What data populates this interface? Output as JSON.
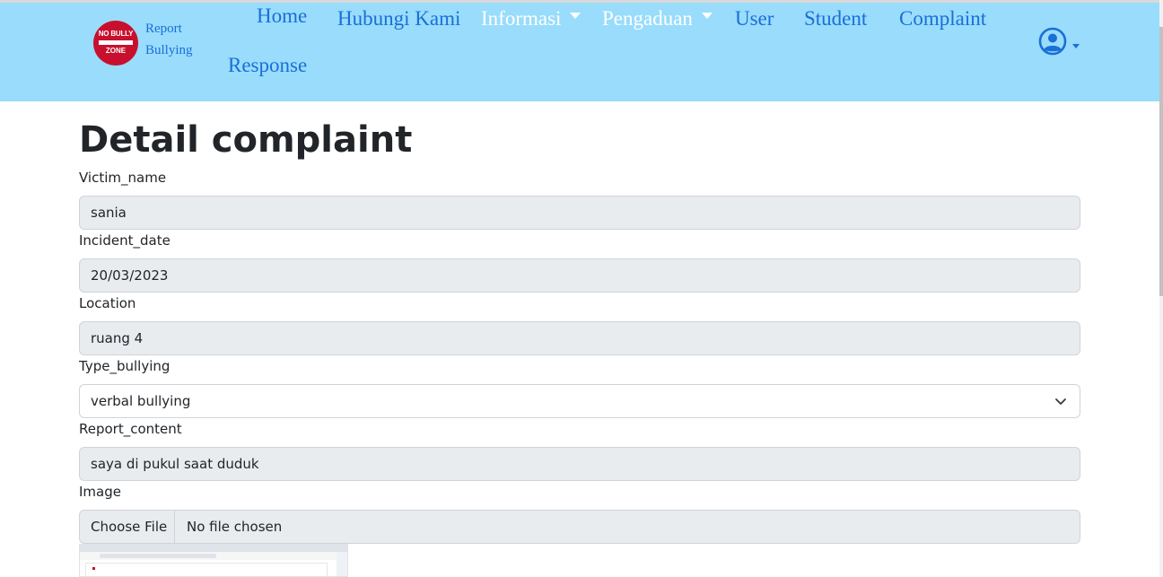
{
  "brand": {
    "logo_line1": "NO BULLY",
    "logo_line2": "ZONE",
    "name_line1": "Report",
    "name_line2": "Bullying"
  },
  "nav": {
    "home": "Home",
    "hubungi": "Hubungi Kami",
    "informasi": "Informasi",
    "pengaduan": "Pengaduan",
    "user": "User",
    "student": "Student",
    "complaint": "Complaint",
    "response": "Response"
  },
  "page": {
    "title": "Detail complaint"
  },
  "form": {
    "victim_label": "Victim_name",
    "victim_value": "sania",
    "date_label": "Incident_date",
    "date_value": "20/03/2023",
    "location_label": "Location",
    "location_value": "ruang 4",
    "type_label": "Type_bullying",
    "type_value": "verbal bullying",
    "content_label": "Report_content",
    "content_value": "saya di pukul saat duduk",
    "image_label": "Image",
    "file_button": "Choose File",
    "file_status": "No file chosen"
  },
  "colors": {
    "navbar_bg": "#99dcfc",
    "link": "#1a6fd6",
    "readonly_bg": "#e9ecef",
    "logo_red": "#c8102e"
  },
  "icons": {
    "logo": "no-bully-zone-logo",
    "user": "user-circle-icon",
    "select": "chevron-down-icon",
    "dropdown": "caret-down-icon"
  }
}
